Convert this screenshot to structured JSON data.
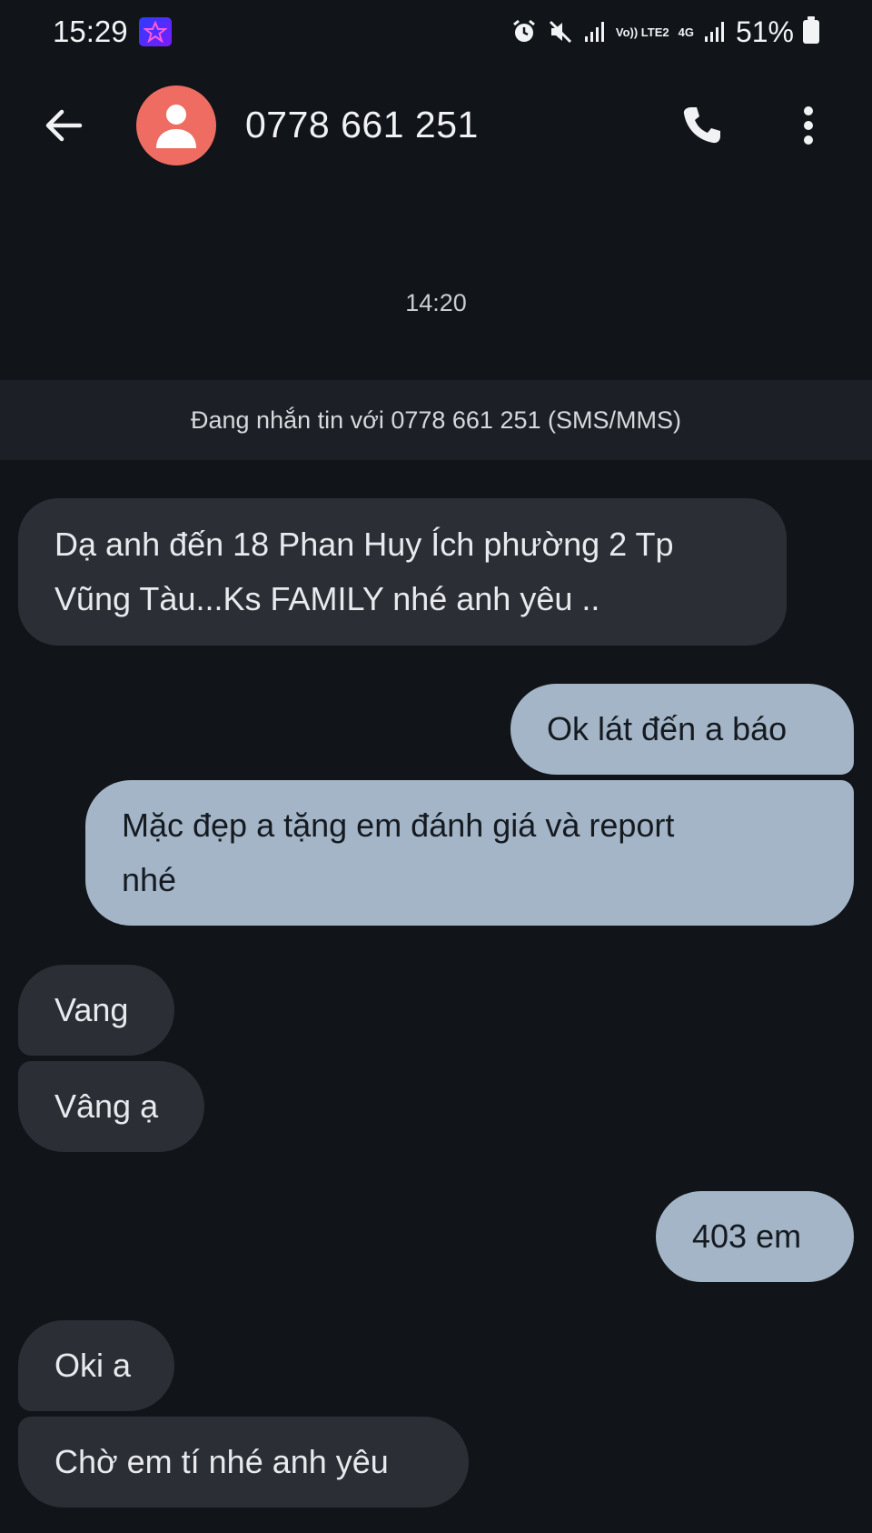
{
  "status_bar": {
    "time": "15:29",
    "network_label": "Vo)) LTE2",
    "network_type": "4G",
    "battery": "51%"
  },
  "header": {
    "contact": "0778 661 251",
    "icons": [
      "back-arrow-icon",
      "avatar-person-icon",
      "phone-icon",
      "more-vertical-icon"
    ]
  },
  "conversation": {
    "timestamp": "14:20",
    "info": "Đang nhắn tin với 0778 661 251 (SMS/MMS)",
    "messages": [
      {
        "direction": "incoming",
        "text": "Dạ anh đến 18 Phan Huy Ích phường 2 Tp\nVũng Tàu...Ks FAMILY nhé anh yêu .."
      },
      {
        "direction": "outgoing",
        "text": "Ok lát đến a báo"
      },
      {
        "direction": "outgoing",
        "text": "Mặc đẹp a tặng em đánh giá và report\nnhé"
      },
      {
        "direction": "incoming",
        "text": "Vang"
      },
      {
        "direction": "incoming",
        "text": "Vâng ạ"
      },
      {
        "direction": "outgoing",
        "text": "403 em"
      },
      {
        "direction": "incoming",
        "text": "Oki a"
      },
      {
        "direction": "incoming",
        "text": "Chờ em tí nhé anh yêu"
      }
    ]
  },
  "colors": {
    "background": "#111418",
    "incoming_bubble": "#2b2f35",
    "outgoing_bubble": "#a3b5c7",
    "avatar": "#ee6c61"
  }
}
